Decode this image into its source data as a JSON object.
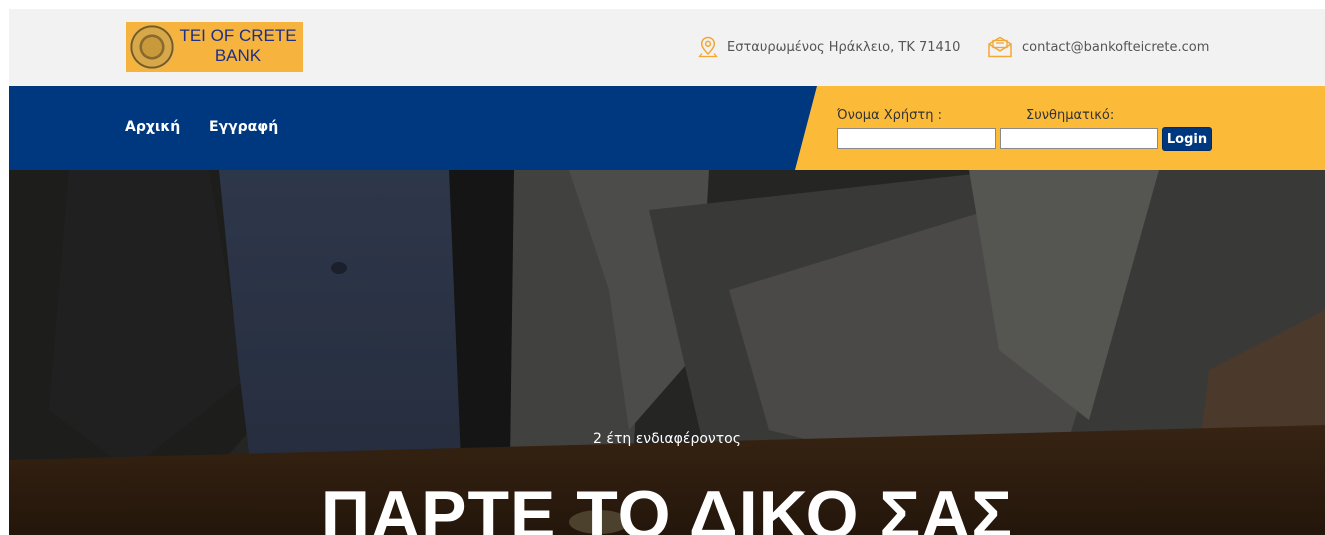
{
  "logo": {
    "line1": "TEI OF CRETE",
    "line2": "BANK"
  },
  "contact": {
    "address": "Εσταυρωμένος Ηράκλειο, ΤΚ 71410",
    "email": "contact@bankofteicrete.com",
    "address_icon": "map-pin-icon",
    "email_icon": "envelope-icon"
  },
  "nav": {
    "items": [
      {
        "label": "Αρχική"
      },
      {
        "label": "Εγγραφή"
      }
    ]
  },
  "login": {
    "username_label": "Όνομα Χρήστη :",
    "password_label": "Συνθηματικό:",
    "username_value": "",
    "password_value": "",
    "button_label": "Login"
  },
  "hero": {
    "subtitle": "2 έτη ενδιαφέροντος",
    "title": "ΠΑΡΤΕ ΤΟ ΔΙΚΟ ΣΑΣ"
  },
  "colors": {
    "topbar_bg": "#f2f2f2",
    "nav_bg": "#00387f",
    "accent_yellow": "#fbbb39",
    "logo_bg": "#f6b43e"
  }
}
